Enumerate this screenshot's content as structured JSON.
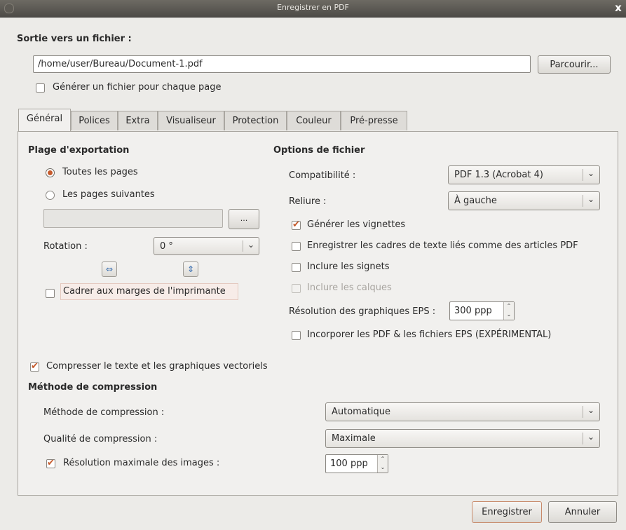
{
  "window": {
    "title": "Enregistrer en PDF",
    "close_glyph": "x"
  },
  "output": {
    "heading": "Sortie vers un fichier :",
    "path": "/home/user/Bureau/Document-1.pdf",
    "browse_label": "Parcourir...",
    "per_page_label": "Générer un fichier pour chaque page",
    "per_page_checked": false
  },
  "tabs": [
    {
      "label": "Général",
      "active": true
    },
    {
      "label": "Polices"
    },
    {
      "label": "Extra"
    },
    {
      "label": "Visualiseur"
    },
    {
      "label": "Protection"
    },
    {
      "label": "Couleur"
    },
    {
      "label": "Pré-presse"
    }
  ],
  "export_range": {
    "heading": "Plage d'exportation",
    "all_pages_label": "Toutes les pages",
    "all_pages_selected": true,
    "following_pages_label": "Les pages suivantes",
    "pages_value": "",
    "dots_label": "...",
    "rotation_label": "Rotation :",
    "rotation_value": "0 °",
    "fit_margins_label": "Cadrer aux marges de l'imprimante",
    "fit_margins_checked": false
  },
  "file_options": {
    "heading": "Options de fichier",
    "compat_label": "Compatibilité :",
    "compat_value": "PDF 1.3 (Acrobat 4)",
    "binding_label": "Reliure :",
    "binding_value": "À gauche",
    "thumbnails_label": "Générer les vignettes",
    "thumbnails_checked": true,
    "articles_label": "Enregistrer les cadres de texte liés comme des articles PDF",
    "articles_checked": false,
    "bookmarks_label": "Inclure les signets",
    "bookmarks_checked": false,
    "layers_label": "Inclure les calques",
    "layers_checked": false,
    "eps_res_label": "Résolution des graphiques EPS :",
    "eps_res_value": "300 ppp",
    "embed_label": "Incorporer les PDF & les fichiers EPS (EXPÉRIMENTAL)",
    "embed_checked": false
  },
  "compression": {
    "compress_label": "Compresser le texte et les graphiques vectoriels",
    "compress_checked": true,
    "heading": "Méthode de compression",
    "method_label": "Méthode de compression :",
    "method_value": "Automatique",
    "quality_label": "Qualité de compression :",
    "quality_value": "Maximale",
    "maxres_label": "Résolution maximale des images :",
    "maxres_checked": true,
    "maxres_value": "100 ppp"
  },
  "footer": {
    "save_label": "Enregistrer",
    "cancel_label": "Annuler"
  },
  "colors": {
    "accent": "#c55a2c",
    "titlebar": "#4d4b47",
    "background": "#ecebe8"
  },
  "icons": [
    "close-icon",
    "chevron-down-icon",
    "rotate-horizontal-icon",
    "rotate-vertical-icon",
    "spin-up-down-icon"
  ]
}
